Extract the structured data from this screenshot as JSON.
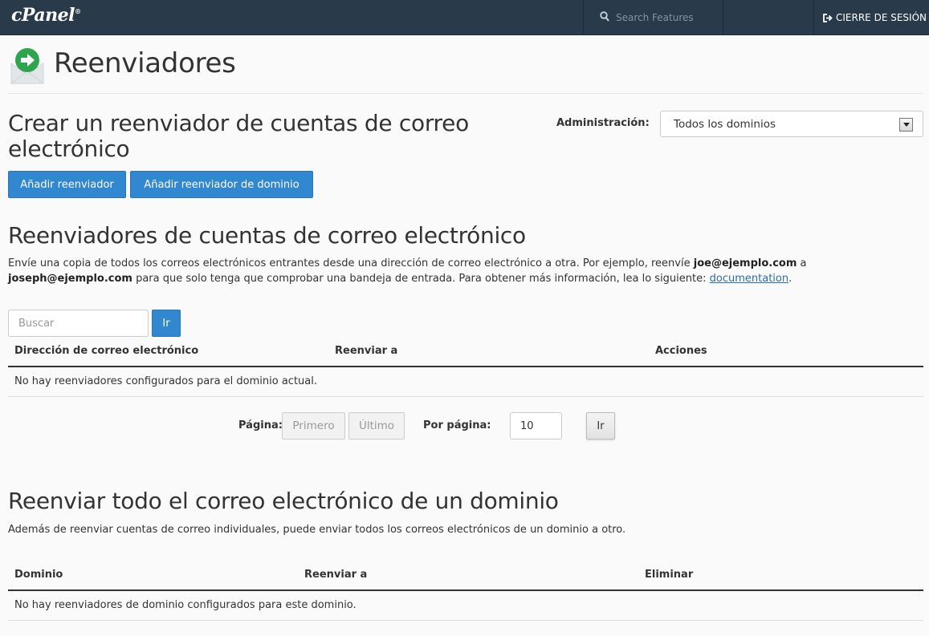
{
  "topbar": {
    "logo": "cPanel",
    "logo_mark": "®",
    "search_placeholder": "Search Features",
    "logout_label": "CIERRE DE SESIÓN"
  },
  "page": {
    "title": "Reenviadores"
  },
  "create": {
    "heading_line1": "Crear un reenviador de cuentas de correo",
    "heading_line2": "electrónico",
    "add_forwarder": "Añadir reenviador",
    "add_domain_forwarder": "Añadir reenviador de dominio",
    "admin_label": "Administración:",
    "admin_selected": "Todos los dominios"
  },
  "accounts": {
    "heading": "Reenviadores de cuentas de correo electrónico",
    "desc_part1": "Envíe una copia de todos los correos electrónicos entrantes desde una dirección de correo electrónico a otra. Por ejemplo, reenvíe ",
    "desc_bold1": "joe@ejemplo.com",
    "desc_part2": " a",
    "desc_bold2": "joseph@ejemplo.com",
    "desc_part3": " para que solo tenga que comprobar una bandeja de entrada. Para obtener más información, lea lo siguiente: ",
    "desc_link": "documentation",
    "desc_end": ".",
    "search_placeholder": "Buscar",
    "go_label": "Ir",
    "columns": [
      "Dirección de correo electrónico",
      "Reenviar a",
      "Acciones"
    ],
    "empty_message": "No hay reenviadores configurados para el dominio actual.",
    "pager": {
      "page_label": "Página:",
      "first": "Primero",
      "last": "Último",
      "per_page_label": "Por página:",
      "per_page_value": "10",
      "go_label": "Ir"
    }
  },
  "domain": {
    "heading": "Reenviar todo el correo electrónico de un dominio",
    "desc": "Además de reenviar cuentas de correo individuales, puede enviar todos los correos electrónicos de un dominio a otro.",
    "columns": [
      "Dominio",
      "Reenviar a",
      "Eliminar"
    ],
    "empty_message": "No hay reenviadores de dominio configurados para este dominio."
  },
  "colors": {
    "topbar": "#293a4a",
    "primary_button": "#3187d0",
    "link": "#2a6eab",
    "icon_green": "#2ea44f"
  }
}
